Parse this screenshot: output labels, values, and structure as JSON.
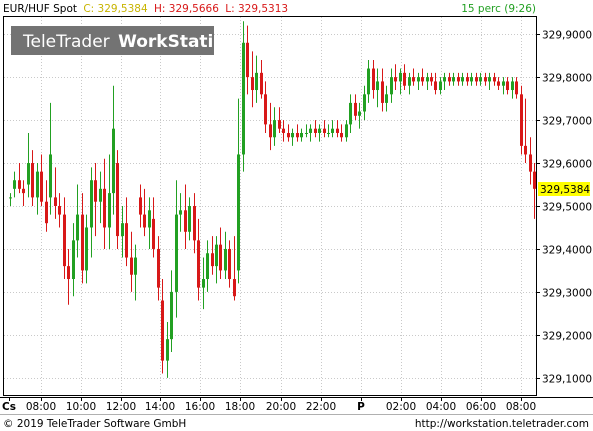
{
  "header": {
    "symbol": "EUR/HUF Spot",
    "close_label": "C:",
    "close_value": "329,5384",
    "high_label": "H:",
    "high_value": "329,5666",
    "low_label": "L:",
    "low_value": "329,5313",
    "interval": "15 perc (9:26)"
  },
  "watermark": {
    "brand": "TeleTrader",
    "product": "WorkStation"
  },
  "last_price_tag": "329,5384",
  "footer": {
    "copyright": "© 2019 TeleTrader Software GmbH",
    "url": "http://workstation.teletrader.com"
  },
  "colors": {
    "up": "#22a022",
    "down": "#d81818",
    "close_value": "#c8b400",
    "high_value": "#d81818",
    "low_value": "#d81818",
    "interval": "#22a022",
    "grid": "#c9c9c9",
    "price_tag": "#ffff00"
  },
  "chart_data": {
    "type": "candlestick",
    "y_ticks": [
      "329,9000",
      "329,8000",
      "329,7000",
      "329,6000",
      "329,5000",
      "329,4000",
      "329,3000",
      "329,2000",
      "329,1000"
    ],
    "x_ticks": [
      "Cs",
      "08:00",
      "10:00",
      "12:00",
      "14:00",
      "16:00",
      "18:00",
      "20:00",
      "22:00",
      "P",
      "02:00",
      "04:00",
      "06:00",
      "08:00"
    ],
    "ylim": [
      329.06,
      329.94
    ],
    "grid": true,
    "candles": [
      [
        329.52,
        329.53,
        329.5,
        329.52
      ],
      [
        329.54,
        329.58,
        329.52,
        329.56
      ],
      [
        329.56,
        329.6,
        329.53,
        329.54
      ],
      [
        329.54,
        329.56,
        329.5,
        329.53
      ],
      [
        329.55,
        329.67,
        329.52,
        329.6
      ],
      [
        329.6,
        329.63,
        329.5,
        329.52
      ],
      [
        329.52,
        329.6,
        329.48,
        329.58
      ],
      [
        329.58,
        329.62,
        329.5,
        329.51
      ],
      [
        329.51,
        329.56,
        329.44,
        329.46
      ],
      [
        329.52,
        329.74,
        329.48,
        329.62
      ],
      [
        329.52,
        329.59,
        329.47,
        329.5
      ],
      [
        329.5,
        329.53,
        329.45,
        329.48
      ],
      [
        329.48,
        329.52,
        329.33,
        329.36
      ],
      [
        329.36,
        329.4,
        329.27,
        329.33
      ],
      [
        329.33,
        329.46,
        329.29,
        329.42
      ],
      [
        329.42,
        329.55,
        329.38,
        329.48
      ],
      [
        329.48,
        329.53,
        329.32,
        329.35
      ],
      [
        329.35,
        329.48,
        329.32,
        329.45
      ],
      [
        329.45,
        329.59,
        329.38,
        329.56
      ],
      [
        329.56,
        329.6,
        329.43,
        329.51
      ],
      [
        329.51,
        329.58,
        329.46,
        329.54
      ],
      [
        329.54,
        329.61,
        329.4,
        329.45
      ],
      [
        329.45,
        329.62,
        329.4,
        329.53
      ],
      [
        329.53,
        329.78,
        329.48,
        329.68
      ],
      [
        329.6,
        329.63,
        329.4,
        329.43
      ],
      [
        329.43,
        329.5,
        329.38,
        329.46
      ],
      [
        329.46,
        329.52,
        329.36,
        329.38
      ],
      [
        329.38,
        329.44,
        329.3,
        329.34
      ],
      [
        329.34,
        329.41,
        329.28,
        329.38
      ],
      [
        329.52,
        329.55,
        329.45,
        329.48
      ],
      [
        329.48,
        329.54,
        329.43,
        329.45
      ],
      [
        329.45,
        329.52,
        329.4,
        329.49
      ],
      [
        329.47,
        329.52,
        329.38,
        329.4
      ],
      [
        329.4,
        329.43,
        329.28,
        329.31
      ],
      [
        329.28,
        329.33,
        329.11,
        329.14
      ],
      [
        329.14,
        329.23,
        329.1,
        329.19
      ],
      [
        329.19,
        329.35,
        329.16,
        329.3
      ],
      [
        329.3,
        329.56,
        329.24,
        329.48
      ],
      [
        329.48,
        329.53,
        329.44,
        329.49
      ],
      [
        329.49,
        329.55,
        329.4,
        329.44
      ],
      [
        329.44,
        329.52,
        329.42,
        329.5
      ],
      [
        329.5,
        329.53,
        329.39,
        329.42
      ],
      [
        329.42,
        329.47,
        329.28,
        329.31
      ],
      [
        329.31,
        329.38,
        329.26,
        329.33
      ],
      [
        329.33,
        329.42,
        329.3,
        329.39
      ],
      [
        329.39,
        329.43,
        329.34,
        329.36
      ],
      [
        329.36,
        329.43,
        329.32,
        329.41
      ],
      [
        329.41,
        329.45,
        329.33,
        329.35
      ],
      [
        329.35,
        329.44,
        329.33,
        329.4
      ],
      [
        329.4,
        329.42,
        329.31,
        329.33
      ],
      [
        329.33,
        329.43,
        329.28,
        329.29
      ],
      [
        329.35,
        329.75,
        329.32,
        329.62
      ],
      [
        329.62,
        329.93,
        329.58,
        329.88
      ],
      [
        329.88,
        329.92,
        329.76,
        329.8
      ],
      [
        329.8,
        329.86,
        329.73,
        329.77
      ],
      [
        329.77,
        329.85,
        329.74,
        329.81
      ],
      [
        329.81,
        329.84,
        329.75,
        329.76
      ],
      [
        329.76,
        329.79,
        329.67,
        329.69
      ],
      [
        329.69,
        329.74,
        329.63,
        329.66
      ],
      [
        329.66,
        329.73,
        329.64,
        329.7
      ],
      [
        329.7,
        329.73,
        329.67,
        329.68
      ],
      [
        329.68,
        329.7,
        329.65,
        329.67
      ],
      [
        329.67,
        329.69,
        329.65,
        329.66
      ],
      [
        329.66,
        329.68,
        329.64,
        329.67
      ],
      [
        329.67,
        329.69,
        329.65,
        329.66
      ],
      [
        329.66,
        329.68,
        329.65,
        329.67
      ],
      [
        329.67,
        329.69,
        329.66,
        329.67
      ],
      [
        329.67,
        329.69,
        329.65,
        329.68
      ],
      [
        329.68,
        329.7,
        329.66,
        329.67
      ],
      [
        329.67,
        329.69,
        329.65,
        329.68
      ],
      [
        329.68,
        329.7,
        329.66,
        329.67
      ],
      [
        329.67,
        329.69,
        329.66,
        329.67
      ],
      [
        329.67,
        329.7,
        329.66,
        329.68
      ],
      [
        329.68,
        329.7,
        329.66,
        329.67
      ],
      [
        329.67,
        329.69,
        329.65,
        329.66
      ],
      [
        329.66,
        329.7,
        329.65,
        329.69
      ],
      [
        329.69,
        329.76,
        329.67,
        329.74
      ],
      [
        329.74,
        329.76,
        329.7,
        329.71
      ],
      [
        329.71,
        329.74,
        329.68,
        329.72
      ],
      [
        329.72,
        329.78,
        329.7,
        329.76
      ],
      [
        329.76,
        329.84,
        329.74,
        329.82
      ],
      [
        329.82,
        329.84,
        329.75,
        329.77
      ],
      [
        329.77,
        329.82,
        329.73,
        329.79
      ],
      [
        329.79,
        329.82,
        329.72,
        329.74
      ],
      [
        329.74,
        329.78,
        329.72,
        329.76
      ],
      [
        329.76,
        329.82,
        329.74,
        329.8
      ],
      [
        329.8,
        329.83,
        329.77,
        329.79
      ],
      [
        329.79,
        329.82,
        329.76,
        329.81
      ],
      [
        329.81,
        329.83,
        329.77,
        329.78
      ],
      [
        329.78,
        329.81,
        329.76,
        329.8
      ],
      [
        329.8,
        329.82,
        329.78,
        329.79
      ],
      [
        329.79,
        329.81,
        329.77,
        329.8
      ],
      [
        329.8,
        329.82,
        329.78,
        329.79
      ],
      [
        329.79,
        329.81,
        329.77,
        329.8
      ],
      [
        329.8,
        329.81,
        329.78,
        329.79
      ],
      [
        329.79,
        329.81,
        329.76,
        329.77
      ],
      [
        329.77,
        329.8,
        329.76,
        329.79
      ],
      [
        329.79,
        329.81,
        329.77,
        329.8
      ],
      [
        329.8,
        329.81,
        329.78,
        329.79
      ],
      [
        329.79,
        329.81,
        329.78,
        329.8
      ],
      [
        329.8,
        329.81,
        329.78,
        329.79
      ],
      [
        329.79,
        329.81,
        329.78,
        329.8
      ],
      [
        329.8,
        329.81,
        329.78,
        329.79
      ],
      [
        329.79,
        329.81,
        329.78,
        329.8
      ],
      [
        329.8,
        329.81,
        329.78,
        329.79
      ],
      [
        329.79,
        329.81,
        329.78,
        329.8
      ],
      [
        329.8,
        329.81,
        329.78,
        329.79
      ],
      [
        329.79,
        329.81,
        329.77,
        329.8
      ],
      [
        329.8,
        329.81,
        329.78,
        329.79
      ],
      [
        329.79,
        329.8,
        329.77,
        329.78
      ],
      [
        329.78,
        329.8,
        329.76,
        329.79
      ],
      [
        329.79,
        329.8,
        329.76,
        329.77
      ],
      [
        329.77,
        329.8,
        329.75,
        329.79
      ],
      [
        329.79,
        329.8,
        329.75,
        329.76
      ],
      [
        329.76,
        329.78,
        329.62,
        329.64
      ],
      [
        329.64,
        329.75,
        329.6,
        329.62
      ],
      [
        329.62,
        329.66,
        329.55,
        329.58
      ],
      [
        329.58,
        329.6,
        329.47,
        329.54
      ]
    ]
  }
}
